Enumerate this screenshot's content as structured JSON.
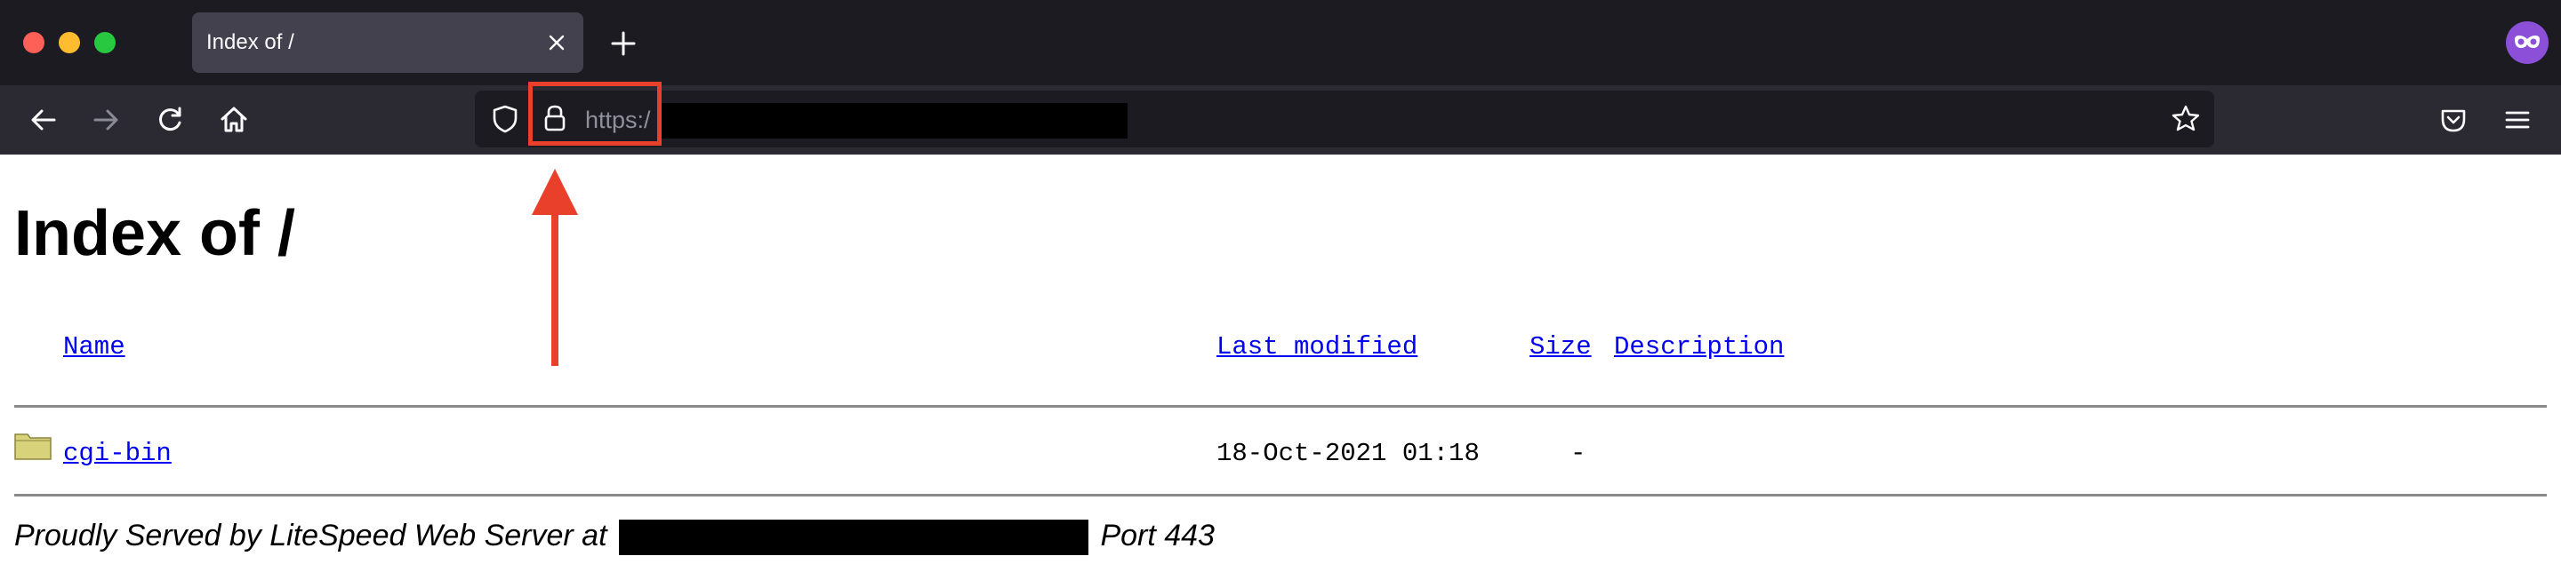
{
  "browser": {
    "tab": {
      "title": "Index of /",
      "close_icon": "close-icon"
    },
    "new_tab_icon": "plus-icon",
    "url": {
      "visible_text": "https:/",
      "secure": true
    },
    "highlight_color": "#e8402a"
  },
  "page": {
    "title": "Index of /",
    "columns": {
      "name": "Name",
      "last_modified": "Last modified",
      "size": "Size",
      "description": "Description"
    },
    "rows": [
      {
        "name": "cgi-bin",
        "last_modified": "18-Oct-2021 01:18",
        "size": "-",
        "description": ""
      }
    ],
    "footer": {
      "prefix": "Proudly Served by LiteSpeed Web Server at",
      "suffix": "Port 443"
    }
  }
}
